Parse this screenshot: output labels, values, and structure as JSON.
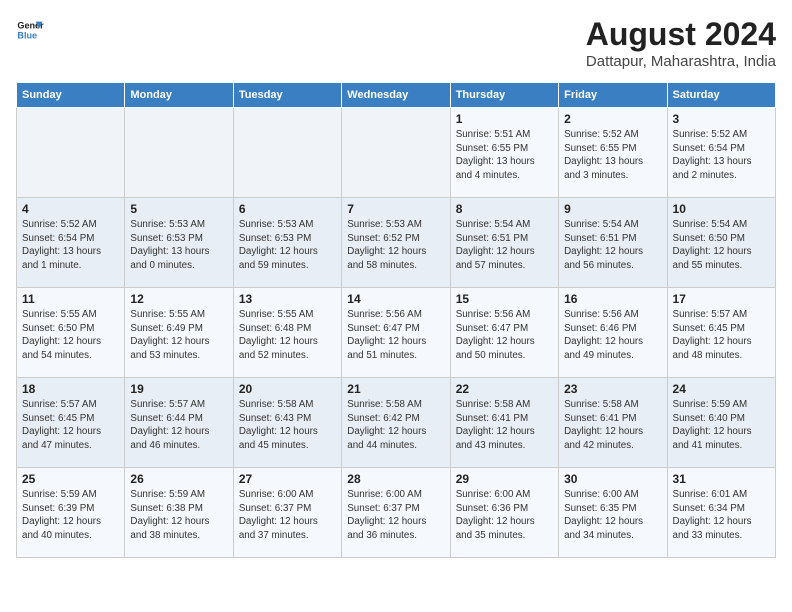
{
  "header": {
    "logo_line1": "General",
    "logo_line2": "Blue",
    "title": "August 2024",
    "subtitle": "Dattapur, Maharashtra, India"
  },
  "weekdays": [
    "Sunday",
    "Monday",
    "Tuesday",
    "Wednesday",
    "Thursday",
    "Friday",
    "Saturday"
  ],
  "weeks": [
    [
      {
        "day": "",
        "info": ""
      },
      {
        "day": "",
        "info": ""
      },
      {
        "day": "",
        "info": ""
      },
      {
        "day": "",
        "info": ""
      },
      {
        "day": "1",
        "info": "Sunrise: 5:51 AM\nSunset: 6:55 PM\nDaylight: 13 hours\nand 4 minutes."
      },
      {
        "day": "2",
        "info": "Sunrise: 5:52 AM\nSunset: 6:55 PM\nDaylight: 13 hours\nand 3 minutes."
      },
      {
        "day": "3",
        "info": "Sunrise: 5:52 AM\nSunset: 6:54 PM\nDaylight: 13 hours\nand 2 minutes."
      }
    ],
    [
      {
        "day": "4",
        "info": "Sunrise: 5:52 AM\nSunset: 6:54 PM\nDaylight: 13 hours\nand 1 minute."
      },
      {
        "day": "5",
        "info": "Sunrise: 5:53 AM\nSunset: 6:53 PM\nDaylight: 13 hours\nand 0 minutes."
      },
      {
        "day": "6",
        "info": "Sunrise: 5:53 AM\nSunset: 6:53 PM\nDaylight: 12 hours\nand 59 minutes."
      },
      {
        "day": "7",
        "info": "Sunrise: 5:53 AM\nSunset: 6:52 PM\nDaylight: 12 hours\nand 58 minutes."
      },
      {
        "day": "8",
        "info": "Sunrise: 5:54 AM\nSunset: 6:51 PM\nDaylight: 12 hours\nand 57 minutes."
      },
      {
        "day": "9",
        "info": "Sunrise: 5:54 AM\nSunset: 6:51 PM\nDaylight: 12 hours\nand 56 minutes."
      },
      {
        "day": "10",
        "info": "Sunrise: 5:54 AM\nSunset: 6:50 PM\nDaylight: 12 hours\nand 55 minutes."
      }
    ],
    [
      {
        "day": "11",
        "info": "Sunrise: 5:55 AM\nSunset: 6:50 PM\nDaylight: 12 hours\nand 54 minutes."
      },
      {
        "day": "12",
        "info": "Sunrise: 5:55 AM\nSunset: 6:49 PM\nDaylight: 12 hours\nand 53 minutes."
      },
      {
        "day": "13",
        "info": "Sunrise: 5:55 AM\nSunset: 6:48 PM\nDaylight: 12 hours\nand 52 minutes."
      },
      {
        "day": "14",
        "info": "Sunrise: 5:56 AM\nSunset: 6:47 PM\nDaylight: 12 hours\nand 51 minutes."
      },
      {
        "day": "15",
        "info": "Sunrise: 5:56 AM\nSunset: 6:47 PM\nDaylight: 12 hours\nand 50 minutes."
      },
      {
        "day": "16",
        "info": "Sunrise: 5:56 AM\nSunset: 6:46 PM\nDaylight: 12 hours\nand 49 minutes."
      },
      {
        "day": "17",
        "info": "Sunrise: 5:57 AM\nSunset: 6:45 PM\nDaylight: 12 hours\nand 48 minutes."
      }
    ],
    [
      {
        "day": "18",
        "info": "Sunrise: 5:57 AM\nSunset: 6:45 PM\nDaylight: 12 hours\nand 47 minutes."
      },
      {
        "day": "19",
        "info": "Sunrise: 5:57 AM\nSunset: 6:44 PM\nDaylight: 12 hours\nand 46 minutes."
      },
      {
        "day": "20",
        "info": "Sunrise: 5:58 AM\nSunset: 6:43 PM\nDaylight: 12 hours\nand 45 minutes."
      },
      {
        "day": "21",
        "info": "Sunrise: 5:58 AM\nSunset: 6:42 PM\nDaylight: 12 hours\nand 44 minutes."
      },
      {
        "day": "22",
        "info": "Sunrise: 5:58 AM\nSunset: 6:41 PM\nDaylight: 12 hours\nand 43 minutes."
      },
      {
        "day": "23",
        "info": "Sunrise: 5:58 AM\nSunset: 6:41 PM\nDaylight: 12 hours\nand 42 minutes."
      },
      {
        "day": "24",
        "info": "Sunrise: 5:59 AM\nSunset: 6:40 PM\nDaylight: 12 hours\nand 41 minutes."
      }
    ],
    [
      {
        "day": "25",
        "info": "Sunrise: 5:59 AM\nSunset: 6:39 PM\nDaylight: 12 hours\nand 40 minutes."
      },
      {
        "day": "26",
        "info": "Sunrise: 5:59 AM\nSunset: 6:38 PM\nDaylight: 12 hours\nand 38 minutes."
      },
      {
        "day": "27",
        "info": "Sunrise: 6:00 AM\nSunset: 6:37 PM\nDaylight: 12 hours\nand 37 minutes."
      },
      {
        "day": "28",
        "info": "Sunrise: 6:00 AM\nSunset: 6:37 PM\nDaylight: 12 hours\nand 36 minutes."
      },
      {
        "day": "29",
        "info": "Sunrise: 6:00 AM\nSunset: 6:36 PM\nDaylight: 12 hours\nand 35 minutes."
      },
      {
        "day": "30",
        "info": "Sunrise: 6:00 AM\nSunset: 6:35 PM\nDaylight: 12 hours\nand 34 minutes."
      },
      {
        "day": "31",
        "info": "Sunrise: 6:01 AM\nSunset: 6:34 PM\nDaylight: 12 hours\nand 33 minutes."
      }
    ]
  ]
}
